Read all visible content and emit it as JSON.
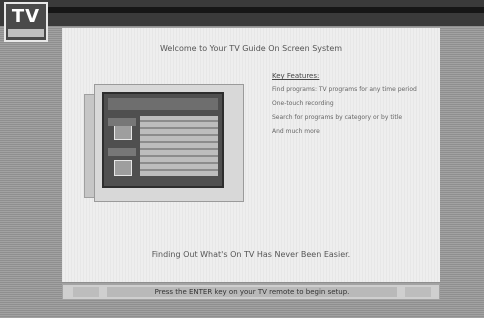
{
  "logo": {
    "text": "TV",
    "alt": "TV Guide logo"
  },
  "welcome": {
    "title": "Welcome to Your TV Guide On Screen System"
  },
  "features": {
    "title": "Key Features:",
    "items": [
      "Find programs: TV programs for any time period",
      "One-touch recording",
      "Search for programs by category or by title",
      "And much more"
    ]
  },
  "tagline": "Finding Out What's On TV Has Never Been Easier.",
  "bottom": {
    "instruction": "Press the ENTER key on your TV remote to begin setup."
  }
}
